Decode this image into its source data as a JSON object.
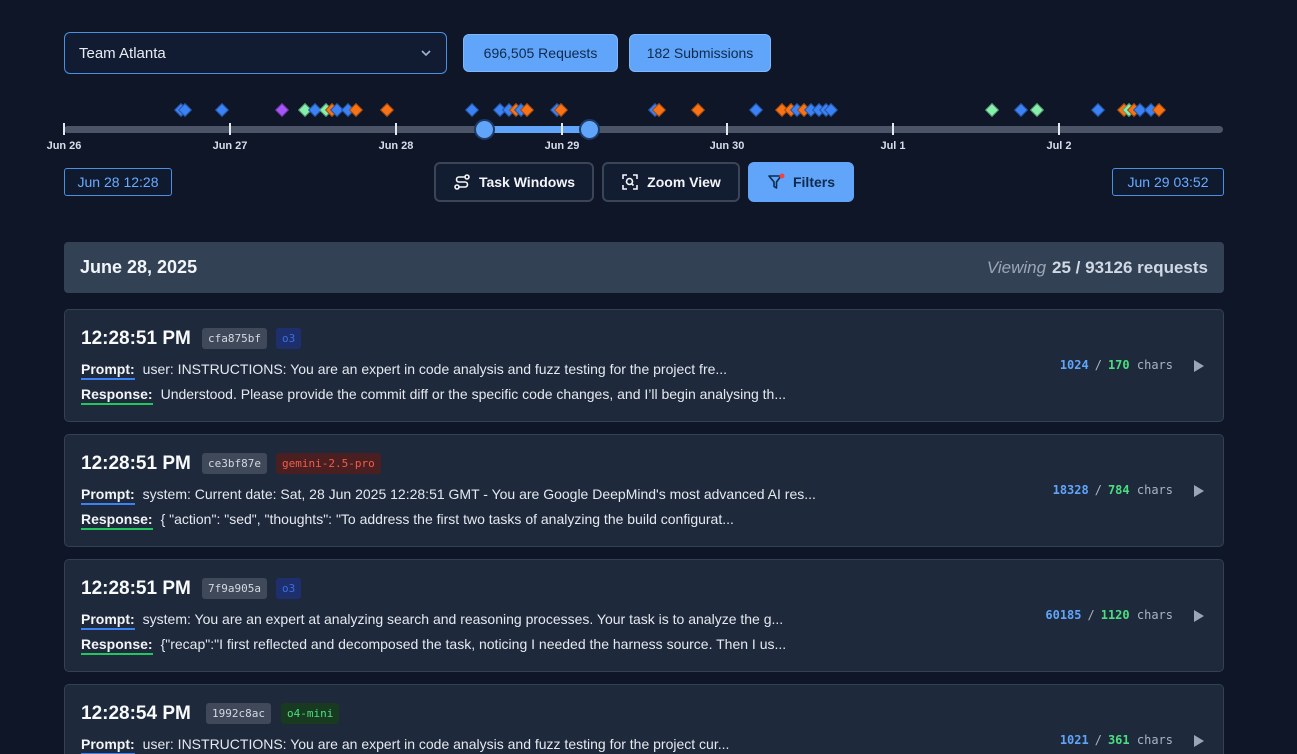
{
  "header": {
    "team": "Team Atlanta",
    "requests_label": "696,505 Requests",
    "submissions_label": "182 Submissions"
  },
  "timeline": {
    "ticks": [
      "Jun 26",
      "Jun 27",
      "Jun 28",
      "Jun 29",
      "Jun 30",
      "Jul 1",
      "Jul 2"
    ],
    "range_start": "Jun 28 12:28",
    "range_end": "Jun 29 03:52",
    "marker_colors": {
      "blue": "#3b82f6",
      "orange": "#f97316",
      "green": "#86efac",
      "purple": "#a855f7"
    }
  },
  "toolbar": {
    "task_windows": "Task Windows",
    "zoom_view": "Zoom View",
    "filters": "Filters"
  },
  "list": {
    "date": "June 28, 2025",
    "viewing_label": "Viewing",
    "viewing_count": "25 / 93126 requests",
    "prompt_label": "Prompt:",
    "response_label": "Response:",
    "chars_unit": "chars",
    "items": [
      {
        "time": "12:28:51 PM",
        "hash": "cfa875bf",
        "model": "o3",
        "prompt": "user: INSTRUCTIONS: You are an expert in code analysis and fuzz testing for the project fre...",
        "response": "Understood. Please provide the commit diff or the specific code changes, and I’ll begin analysing th...",
        "in_chars": "1024",
        "out_chars": "170"
      },
      {
        "time": "12:28:51 PM",
        "hash": "ce3bf87e",
        "model": "gemini-2.5-pro",
        "prompt": "system: Current date: Sat, 28 Jun 2025 12:28:51 GMT - You are Google DeepMind's most advanced AI res...",
        "response": "{ \"action\": \"sed\", \"thoughts\": \"To address the first two tasks of analyzing the build configurat...",
        "in_chars": "18328",
        "out_chars": "784"
      },
      {
        "time": "12:28:51 PM",
        "hash": "7f9a905a",
        "model": "o3",
        "prompt": "system: You are an expert at analyzing search and reasoning processes. Your task is to analyze the g...",
        "response": "{\"recap\":\"I first reflected and decomposed the task, noticing I needed the harness source. Then I us...",
        "in_chars": "60185",
        "out_chars": "1120"
      },
      {
        "time": "12:28:54 PM",
        "hash": "1992c8ac",
        "model": "o4-mini",
        "prompt": "user: INSTRUCTIONS: You are an expert in code analysis and fuzz testing for the project cur...",
        "response": "",
        "in_chars": "1021",
        "out_chars": "361"
      }
    ]
  }
}
